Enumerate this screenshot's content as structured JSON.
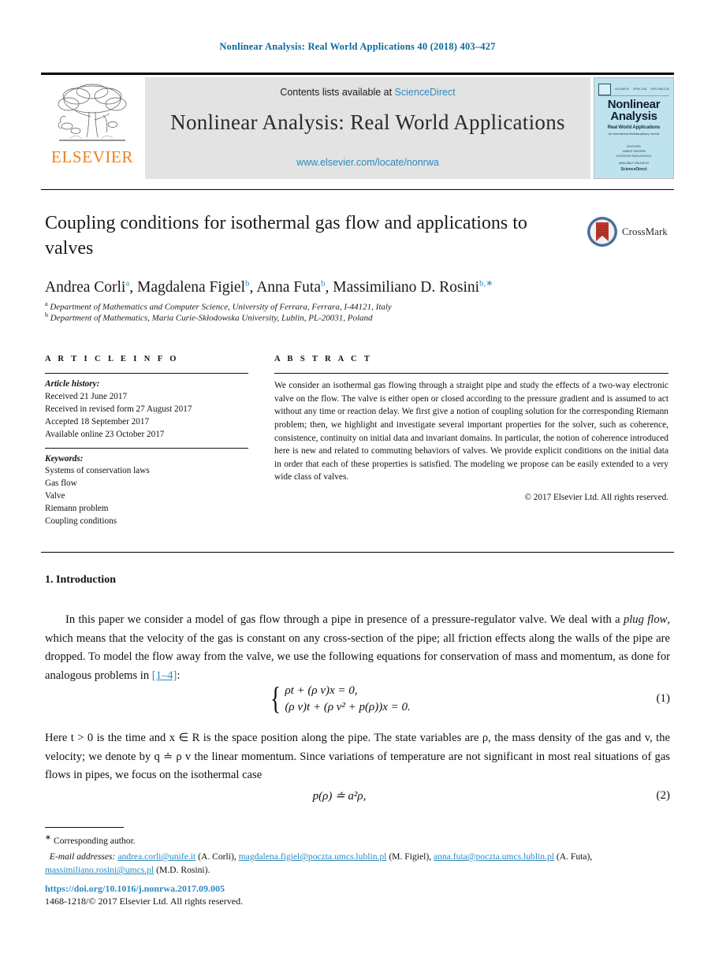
{
  "running_head": "Nonlinear Analysis: Real World Applications 40 (2018) 403–427",
  "masthead": {
    "contents_prefix": "Contents lists available at ",
    "sciencedirect": "ScienceDirect",
    "journal_title": "Nonlinear Analysis: Real World Applications",
    "journal_url": "www.elsevier.com/locate/nonrwa",
    "publisher_wordmark": "ELSEVIER",
    "cover": {
      "title_line1": "Nonlinear",
      "title_line2": "Analysis",
      "subtitle": "Real World Applications",
      "subsubtitle": "An International Multidisciplinary Journal",
      "editors_label": "EDITORS",
      "editor1": "JAMES SERRIN",
      "editor2": "VICENTIU RADULESCU",
      "issn_left": "ISSN 1468-1218",
      "vol_label": "VOLUME 40",
      "date_label": "APRIL 2018",
      "footer_line": "AVAILABLE ONLINE AT",
      "footer_brand": "ScienceDirect"
    }
  },
  "article": {
    "title": "Coupling conditions for isothermal gas flow and applications to valves",
    "crossmark_label": "CrossMark",
    "authors_html": "Andrea Corli<sup>a</sup>, Magdalena Figiel<sup>b</sup>, Anna Futa<sup>b</sup>, Massimiliano D. Rosini<sup>b,∗</sup>",
    "affiliation_a": "Department of Mathematics and Computer Science, University of Ferrara, Ferrara, I-44121, Italy",
    "affiliation_b": "Department of Mathematics, Maria Curie-Skłodowska University, Lublin, PL-20031, Poland"
  },
  "info": {
    "heading": "A R T I C L E   I N F O",
    "history_label": "Article history:",
    "history": [
      "Received 21 June 2017",
      "Received in revised form 27 August 2017",
      "Accepted 18 September 2017",
      "Available online 23 October 2017"
    ],
    "keywords_label": "Keywords:",
    "keywords": [
      "Systems of conservation laws",
      "Gas flow",
      "Valve",
      "Riemann problem",
      "Coupling conditions"
    ]
  },
  "abstract": {
    "heading": "A B S T R A C T",
    "text": "We consider an isothermal gas flowing through a straight pipe and study the effects of a two-way electronic valve on the flow. The valve is either open or closed according to the pressure gradient and is assumed to act without any time or reaction delay. We first give a notion of coupling solution for the corresponding Riemann problem; then, we highlight and investigate several important properties for the solver, such as coherence, consistence, continuity on initial data and invariant domains. In particular, the notion of coherence introduced here is new and related to commuting behaviors of valves. We provide explicit conditions on the initial data in order that each of these properties is satisfied. The modeling we propose can be easily extended to a very wide class of valves.",
    "copyright": "© 2017 Elsevier Ltd. All rights reserved."
  },
  "body": {
    "section_heading": "1.  Introduction",
    "paragraph1_pre": "In this paper we consider a model of gas flow through a pipe in presence of a pressure-regulator valve. We deal with a ",
    "paragraph1_em": "plug flow",
    "paragraph1_mid": ", which means that the velocity of the gas is constant on any cross-section of the pipe; all friction effects along the walls of the pipe are dropped. To model the flow away from the valve, we use the following equations for conservation of mass and momentum, as done for analogous problems in ",
    "paragraph1_cite": "[1–4]",
    "paragraph1_post": ":",
    "equation1_number": "(1)",
    "equation1_line1": "ρt + (ρ v)x = 0,",
    "equation1_line2": "(ρ v)t + (ρ v² + p(ρ))x = 0.",
    "paragraph2": "Here t > 0 is the time and x ∈ R is the space position along the pipe. The state variables are ρ, the mass density of the gas and v, the velocity; we denote by q ≐ ρ v the linear momentum. Since variations of temperature are not significant in most real situations of gas flows in pipes, we focus on the isothermal case",
    "equation2_number": "(2)",
    "equation2_body": "p(ρ) ≐ a²ρ,"
  },
  "footnotes": {
    "corresponding": "Corresponding author.",
    "email_label": "E-mail addresses:",
    "emails": [
      {
        "address": "andrea.corli@unife.it",
        "person": "(A. Corli),"
      },
      {
        "address": "magdalena.figiel@poczta.umcs.lublin.pl",
        "person": "(M. Figiel),"
      },
      {
        "address": "anna.futa@poczta.umcs.lublin.pl",
        "person": "(A. Futa),"
      },
      {
        "address": "massimiliano.rosini@umcs.pl",
        "person": "(M.D. Rosini)."
      }
    ],
    "doi": "https://doi.org/10.1016/j.nonrwa.2017.09.005",
    "issn_line": "1468-1218/© 2017 Elsevier Ltd. All rights reserved."
  }
}
